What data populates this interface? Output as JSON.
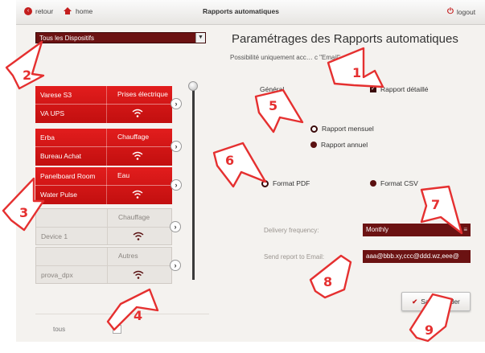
{
  "topbar": {
    "back_label": "retour",
    "home_label": "home",
    "title": "Rapports automatiques",
    "logout_label": "logout"
  },
  "device_filter": {
    "selected": "Tous les Dispositifs",
    "arrow": "▼"
  },
  "devices": [
    {
      "name": "Varese S3",
      "type": "Prises électrique",
      "sub": "VA UPS",
      "style": "red"
    },
    {
      "name": "Erba",
      "type": "Chauffage",
      "sub": "Bureau Achat",
      "style": "red"
    },
    {
      "name": "Panelboard Room",
      "type": "Eau",
      "sub": "Water Pulse",
      "style": "red"
    },
    {
      "name": "",
      "type": "Chauffage",
      "sub": "Device 1",
      "style": "grey"
    },
    {
      "name": "",
      "type": "Autres",
      "sub": "prova_dpx",
      "style": "grey"
    }
  ],
  "bottom": {
    "tous_label": "tous"
  },
  "main": {
    "title": "Paramétrages des Rapports automatiques",
    "subtitle": "Possibilité uniquement acc… c \"Email\"",
    "general_label": "Général",
    "detailed_label": "Rapport détaillé",
    "monthly_label": "Rapport mensuel",
    "annual_label": "Rapport annuel",
    "pdf_label": "Format PDF",
    "csv_label": "Format CSV",
    "frequency_label": "Delivery frequency:",
    "frequency_value": "Monthly",
    "email_label": "Send report to Email:",
    "email_value": "aaa@bbb.xy,ccc@ddd.wz,eee@",
    "save_label": "Sauvegarder"
  },
  "callouts": [
    "1",
    "2",
    "3",
    "4",
    "5",
    "6",
    "7",
    "8",
    "9"
  ],
  "colors": {
    "accent": "#c41e1e",
    "dark_red": "#6b1212",
    "callout": "#e53030"
  }
}
